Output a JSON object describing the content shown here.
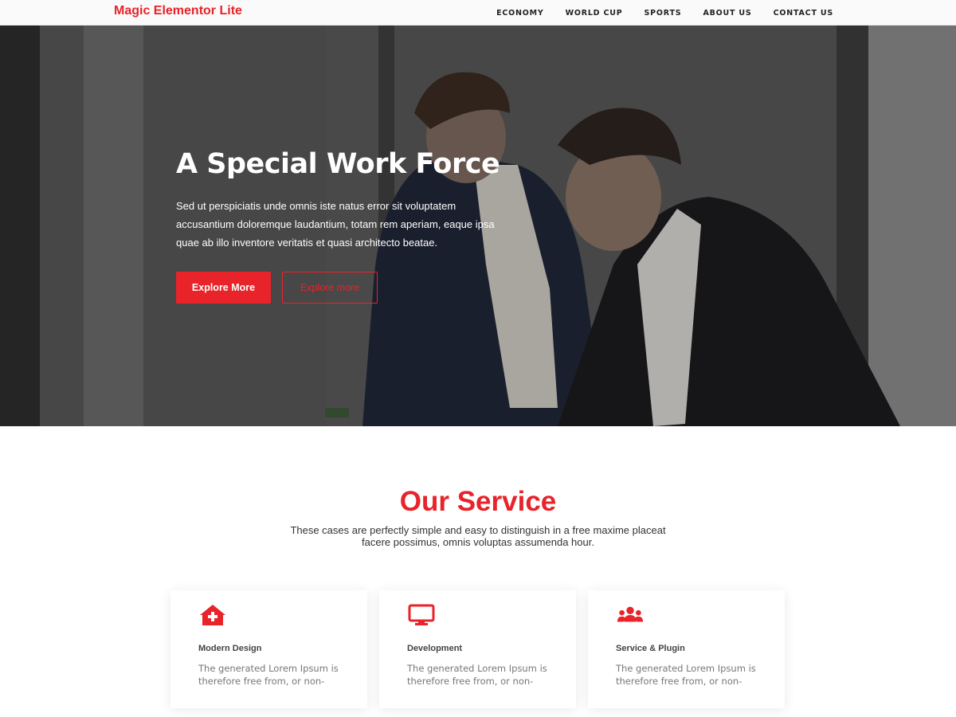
{
  "brand": "Magic Elementor Lite",
  "nav": [
    "ECONOMY",
    "WORLD CUP",
    "SPORTS",
    "ABOUT US",
    "CONTACT US"
  ],
  "hero": {
    "title": "A Special Work Force",
    "text": "Sed ut perspiciatis unde omnis iste natus error sit voluptatem accusantium doloremque laudantium, totam rem aperiam, eaque ipsa quae ab illo inventore veritatis et quasi architecto beatae.",
    "primary_button": "Explore More",
    "secondary_button": "Explore more"
  },
  "service": {
    "title": "Our Service",
    "subtitle": "These cases are perfectly simple and easy to distinguish in a free maxime placeat facere possimus, omnis voluptas assumenda hour.",
    "cards": [
      {
        "icon": "clinic-icon",
        "title": "Modern Design",
        "text": "The generated Lorem Ipsum is therefore free from, or non-"
      },
      {
        "icon": "monitor-icon",
        "title": "Development",
        "text": "The generated Lorem Ipsum is therefore free from, or non-"
      },
      {
        "icon": "users-icon",
        "title": "Service & Plugin",
        "text": "The generated Lorem Ipsum is therefore free from, or non-"
      }
    ]
  },
  "colors": {
    "accent": "#e8232a"
  }
}
